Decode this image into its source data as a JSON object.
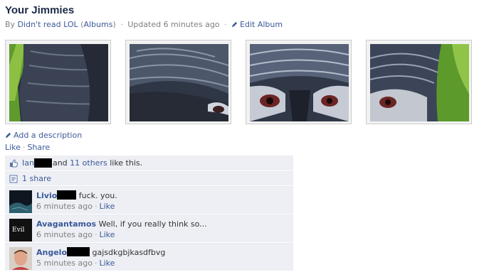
{
  "album": {
    "title": "Your Jimmies",
    "by_label": "By",
    "author": "Didn't read LOL",
    "albums_open": "(",
    "albums_link": "Albums",
    "albums_close": ")",
    "updated": "Updated 6 minutes ago",
    "edit_label": "Edit Album"
  },
  "photos": [
    {
      "name": "photo-1"
    },
    {
      "name": "photo-2"
    },
    {
      "name": "photo-3"
    },
    {
      "name": "photo-4"
    }
  ],
  "actions": {
    "add_description": "Add a description",
    "like": "Like",
    "share": "Share"
  },
  "likes": {
    "first_name": "Ian",
    "and_text": "and",
    "others_link": "11 others",
    "tail": "like this."
  },
  "shares": {
    "count_label": "1 share"
  },
  "comments": [
    {
      "author": "Livio",
      "text": "fuck. you.",
      "time": "6 minutes ago",
      "like": "Like"
    },
    {
      "author": "Avagantamos",
      "text": "Well, if you really think so...",
      "time": "6 minutes ago",
      "like": "Like",
      "avatar_text": "Evil"
    },
    {
      "author": "Angelo",
      "text": "gajsdkgbjkasdfbvg",
      "time": "5 minutes ago",
      "like": "Like"
    }
  ],
  "colors": {
    "link": "#3b5998",
    "ufi_bg": "#edeff4",
    "title": "#1c2a47"
  }
}
